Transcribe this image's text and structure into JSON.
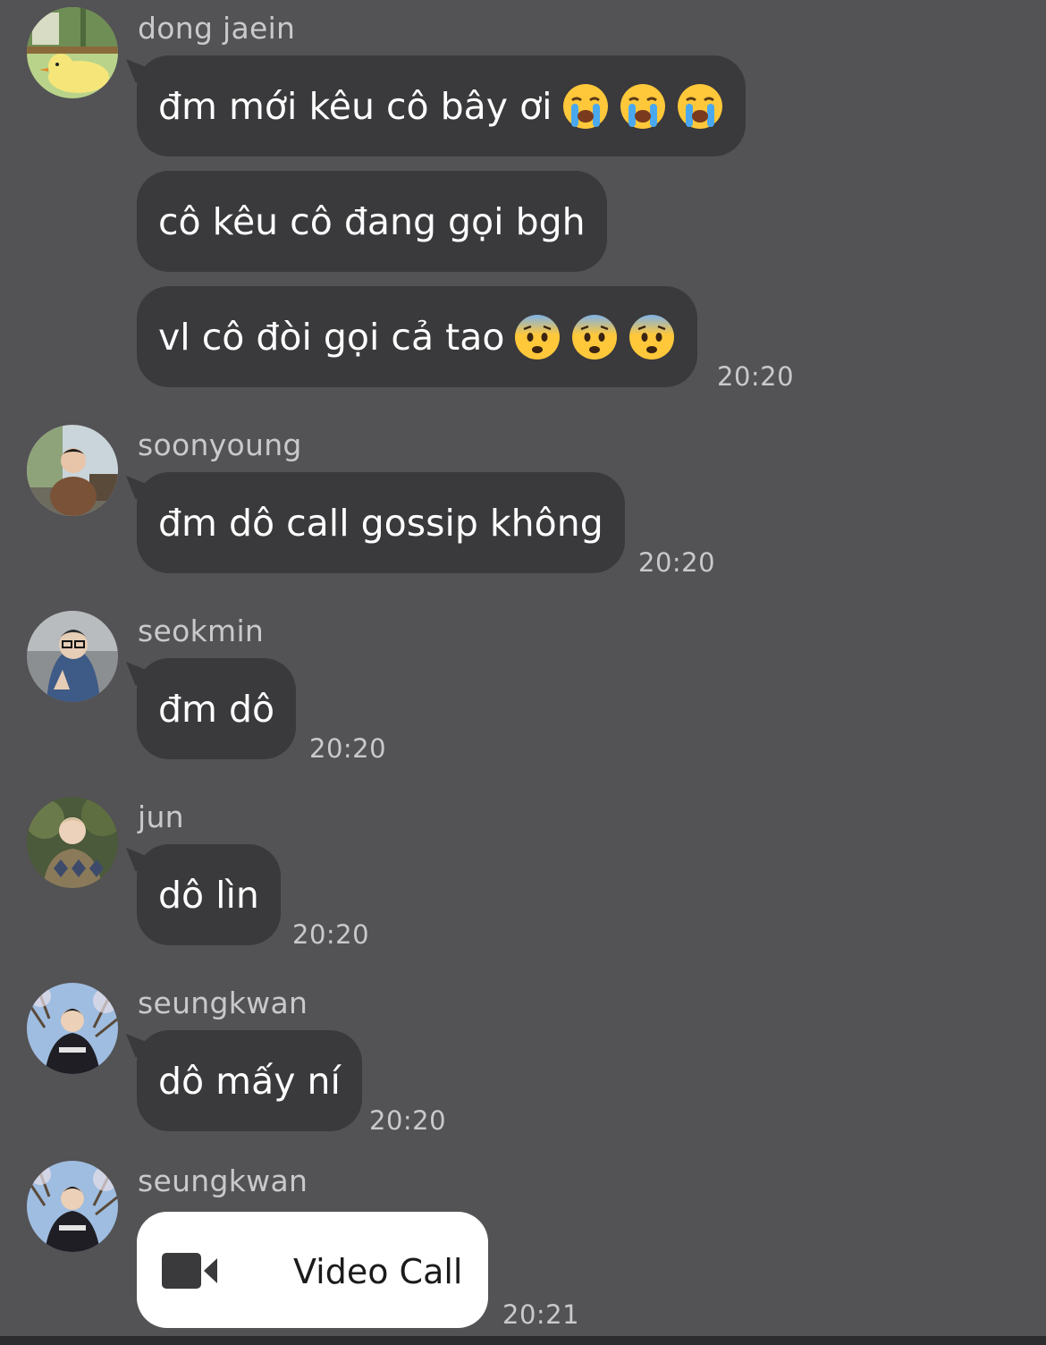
{
  "colors": {
    "background": "#535254",
    "bubble": "#3a393b",
    "text": "#ffffff",
    "meta_text": "#c9c9cb",
    "call_card": "#ffffff"
  },
  "messages": [
    {
      "sender": "dong jaein",
      "avatar_icon": "avatar-cartoon-chick",
      "bubbles": [
        {
          "text": "đm mới kêu cô bây ơi",
          "emoji": [
            "loudly-crying-face",
            "loudly-crying-face",
            "loudly-crying-face"
          ]
        },
        {
          "text": "cô kêu cô đang gọi bgh",
          "emoji": []
        },
        {
          "text": "vl cô đòi gọi cả tao",
          "emoji": [
            "fearful-face",
            "fearful-face",
            "fearful-face"
          ]
        }
      ],
      "time": "20:20"
    },
    {
      "sender": "soonyoung",
      "avatar_icon": "avatar-photo-person-sitting",
      "bubbles": [
        {
          "text": "đm dô call gossip không",
          "emoji": []
        }
      ],
      "time": "20:20"
    },
    {
      "sender": "seokmin",
      "avatar_icon": "avatar-photo-person-glasses",
      "bubbles": [
        {
          "text": "đm dô",
          "emoji": []
        }
      ],
      "time": "20:20"
    },
    {
      "sender": "jun",
      "avatar_icon": "avatar-photo-person-sweater",
      "bubbles": [
        {
          "text": "dô lìn",
          "emoji": []
        }
      ],
      "time": "20:20"
    },
    {
      "sender": "seungkwan",
      "avatar_icon": "avatar-photo-person-trees",
      "bubbles": [
        {
          "text": "dô mấy ní",
          "emoji": []
        }
      ],
      "time": "20:20"
    },
    {
      "sender": "seungkwan",
      "avatar_icon": "avatar-photo-person-trees",
      "call": {
        "icon": "video-camera-icon",
        "label": "Video Call"
      },
      "time": "20:21"
    }
  ]
}
